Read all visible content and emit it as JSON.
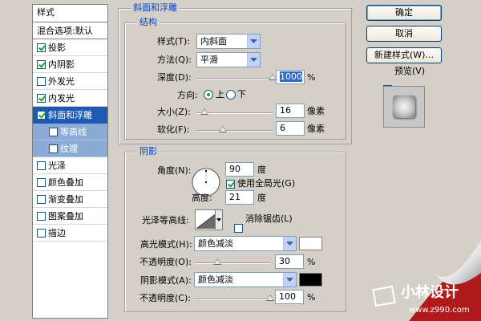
{
  "styles": {
    "header": "样式",
    "blend_item": "混合选项:默认",
    "items": [
      {
        "label": "投影",
        "checked": true
      },
      {
        "label": "内阴影",
        "checked": true
      },
      {
        "label": "外发光",
        "checked": false
      },
      {
        "label": "内发光",
        "checked": true
      },
      {
        "label": "斜面和浮雕",
        "checked": true,
        "selected": true
      },
      {
        "label": "等高线",
        "checked": false,
        "sub": true
      },
      {
        "label": "纹理",
        "checked": false,
        "sub": true
      },
      {
        "label": "光泽",
        "checked": false
      },
      {
        "label": "颜色叠加",
        "checked": false
      },
      {
        "label": "渐变叠加",
        "checked": false
      },
      {
        "label": "图案叠加",
        "checked": false
      },
      {
        "label": "描边",
        "checked": false
      }
    ]
  },
  "bevel": {
    "title": "斜面和浮雕",
    "structure_title": "结构",
    "style_label": "样式(T):",
    "style_value": "内斜面",
    "technique_label": "方法(Q):",
    "technique_value": "平滑",
    "depth_label": "深度(D):",
    "depth_value": "1000",
    "depth_unit": "%",
    "depth_level": 1.0,
    "direction_label": "方向:",
    "direction_up": "上",
    "direction_down": "下",
    "size_label": "大小(Z):",
    "size_value": "16",
    "size_unit": "像素",
    "size_level": 0.1,
    "soften_label": "软化(F):",
    "soften_value": "6",
    "soften_unit": "像素",
    "soften_level": 0.35
  },
  "shading": {
    "title": "阴影",
    "angle_label": "角度(N):",
    "angle_value": "90",
    "angle_unit": "度",
    "global_light_label": "使用全局光(G)",
    "global_light_checked": true,
    "altitude_label": "高度:",
    "altitude_value": "21",
    "altitude_unit": "度",
    "gloss_label": "光泽等高线:",
    "antialias_label": "消除锯齿(L)",
    "antialias_checked": false,
    "highlight_mode_label": "高光模式(H):",
    "highlight_mode_value": "颜色减淡",
    "highlight_color": "#ffffff",
    "highlight_opacity_label": "不透明度(O):",
    "highlight_opacity_value": "30",
    "highlight_opacity_unit": "%",
    "highlight_opacity_level": 0.3,
    "shadow_mode_label": "阴影模式(A):",
    "shadow_mode_value": "颜色减淡",
    "shadow_color": "#000000",
    "shadow_opacity_label": "不透明度(C):",
    "shadow_opacity_value": "100",
    "shadow_opacity_unit": "%",
    "shadow_opacity_level": 1.0
  },
  "buttons": {
    "ok": "确定",
    "cancel": "取消",
    "new_style": "新建样式(W)...",
    "preview_label": "预览(V)",
    "preview_checked": true
  },
  "watermark": {
    "name": "小林设计",
    "url": "www.z990.com"
  },
  "colors": {
    "accent": "#1e5ab4",
    "sub_item": "#8caad6",
    "group_title": "#0046d5",
    "watermark_red": "#b01a1a"
  }
}
